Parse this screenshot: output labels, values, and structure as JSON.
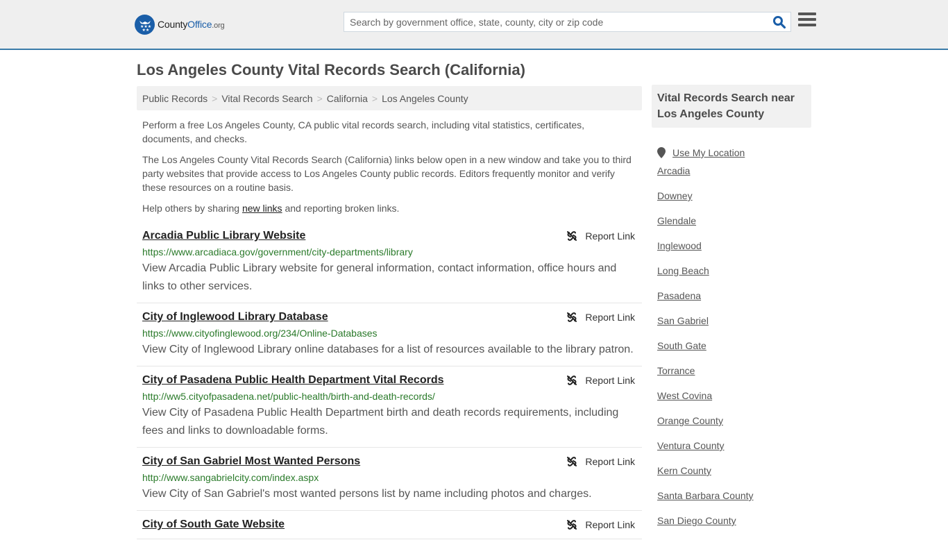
{
  "header": {
    "logo": {
      "part1": "County",
      "part2": "Office",
      "part3": ".org"
    },
    "search": {
      "placeholder": "Search by government office, state, county, city or zip code",
      "value": ""
    },
    "icons": {
      "search": "search-icon",
      "menu": "hamburger-menu-icon"
    }
  },
  "page": {
    "title": "Los Angeles County Vital Records Search (California)"
  },
  "breadcrumb": [
    "Public Records",
    "Vital Records Search",
    "California",
    "Los Angeles County"
  ],
  "intro": {
    "p1": "Perform a free Los Angeles County, CA public vital records search, including vital statistics, certificates, documents, and checks.",
    "p2": "The Los Angeles County Vital Records Search (California) links below open in a new window and take you to third party websites that provide access to Los Angeles County public records. Editors frequently monitor and verify these resources on a routine basis.",
    "p3_before": "Help others by sharing ",
    "p3_link": "new links",
    "p3_after": " and reporting broken links."
  },
  "results": [
    {
      "title": "Arcadia Public Library Website",
      "url": "https://www.arcadiaca.gov/government/city-departments/library",
      "desc": "View Arcadia Public Library website for general information, contact information, office hours and links to other services.",
      "report": "Report Link"
    },
    {
      "title": "City of Inglewood Library Database",
      "url": "https://www.cityofinglewood.org/234/Online-Databases",
      "desc": "View City of Inglewood Library online databases for a list of resources available to the library patron.",
      "report": "Report Link"
    },
    {
      "title": "City of Pasadena Public Health Department Vital Records",
      "url": "http://ww5.cityofpasadena.net/public-health/birth-and-death-records/",
      "desc": "View City of Pasadena Public Health Department birth and death records requirements, including fees and links to downloadable forms.",
      "report": "Report Link"
    },
    {
      "title": "City of San Gabriel Most Wanted Persons",
      "url": "http://www.sangabrielcity.com/index.aspx",
      "desc": "View City of San Gabriel's most wanted persons list by name including photos and charges.",
      "report": "Report Link"
    },
    {
      "title": "City of South Gate Website",
      "url": "",
      "desc": "",
      "report": "Report Link"
    }
  ],
  "sidebar": {
    "heading": "Vital Records Search near Los Angeles County",
    "use_location": "Use My Location",
    "links": [
      "Arcadia",
      "Downey",
      "Glendale",
      "Inglewood",
      "Long Beach",
      "Pasadena",
      "San Gabriel",
      "South Gate",
      "Torrance",
      "West Covina",
      "Orange County",
      "Ventura County",
      "Kern County",
      "Santa Barbara County",
      "San Diego County"
    ]
  },
  "colors": {
    "brand_blue": "#1a5ea8",
    "header_border": "#3a7ba8",
    "url_green": "#2a7a2a"
  }
}
